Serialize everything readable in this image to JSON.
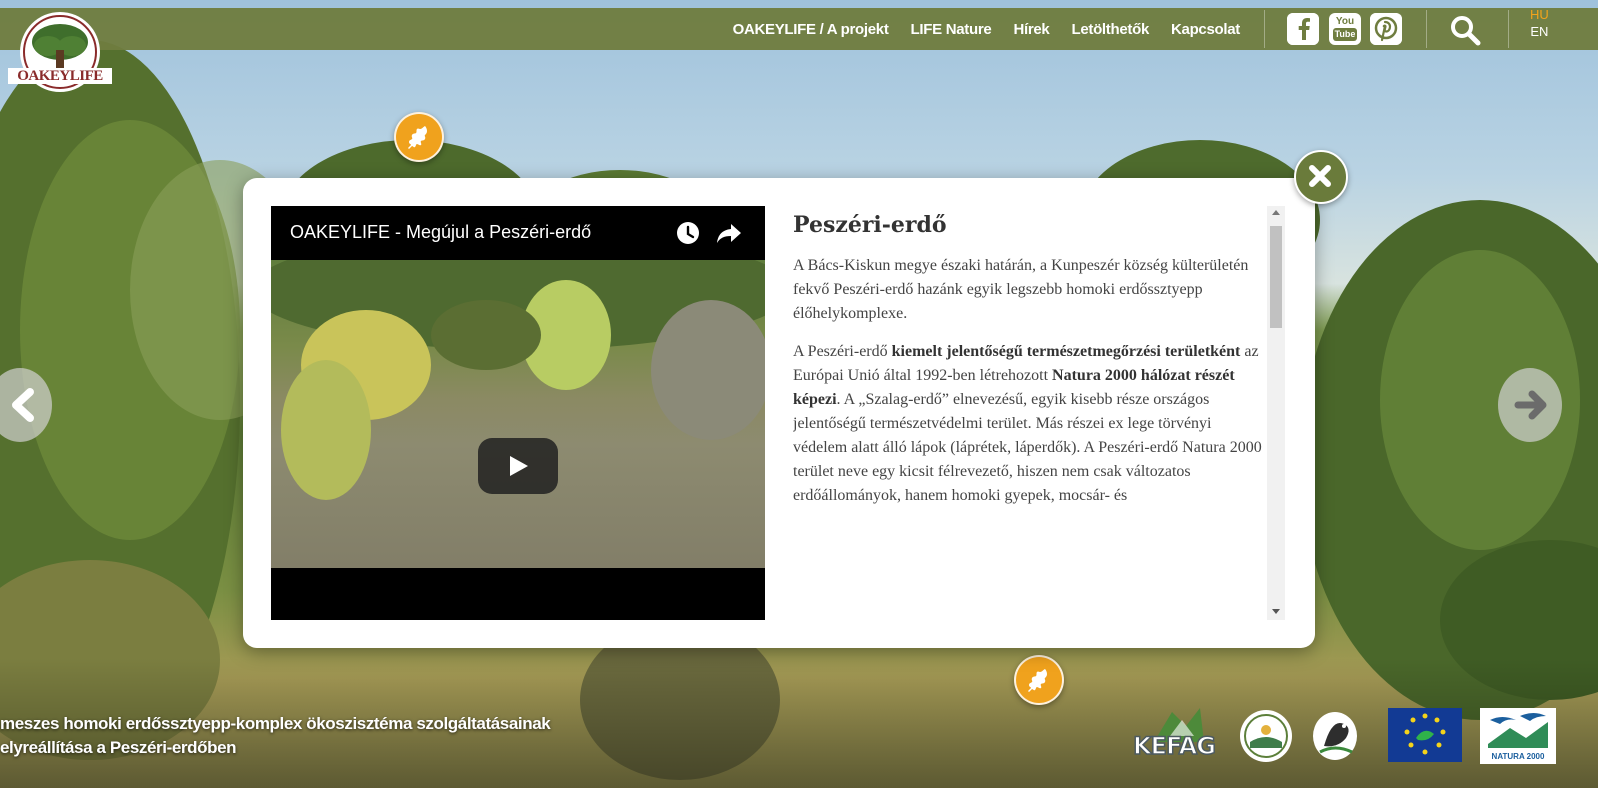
{
  "header": {
    "logo_text": "OAKEYLIFE",
    "nav": [
      {
        "label": "OAKEYLIFE / A projekt"
      },
      {
        "label": "LIFE Nature"
      },
      {
        "label": "Hírek"
      },
      {
        "label": "Letölthetők"
      },
      {
        "label": "Kapcsolat"
      }
    ],
    "social": {
      "youtube_top": "You",
      "youtube_bottom": "Tube"
    },
    "languages": {
      "active": "HU",
      "other": "EN"
    }
  },
  "modal": {
    "video": {
      "title": "OAKEYLIFE - Megújul a Peszéri-erdő"
    },
    "article": {
      "title": "Peszéri-erdő",
      "p1": "A Bács-Kiskun megye északi határán, a Kunpeszér község külterületén fekvő Peszéri-erdő hazánk egyik legszebb homoki erdőssztyepp élőhelykomplexe.",
      "p2_a": "A Peszéri-erdő ",
      "p2_b": "kiemelt jelentőségű természetmegőrzési területként",
      "p2_c": " az Európai Unió által 1992-ben létrehozott ",
      "p2_d": "Natura 2000 hálózat részét képezi",
      "p2_e": ". A „Szalag-erdő” elnevezésű, egyik kisebb része országos jelentőségű természetvédelmi terület.  Más részei ex lege törvényi védelem alatt álló lápok (láprétek, láperdők). A Peszéri-erdő Natura 2000 terület neve egy kicsit félrevezető, hiszen nem csak változatos erdőállományok, hanem homoki gyepek, mocsár- és"
    }
  },
  "caption": {
    "line1": "meszes homoki erdőssztyepp-komplex ökoszisztéma szolgáltatásainak",
    "line2": "elyreállítása a Peszéri-erdőben"
  },
  "partners": {
    "kefag": "KEFAG",
    "natura": "NATURA 2000"
  },
  "colors": {
    "topbar": "#6f7d3f",
    "hotspot": "#f0a21d",
    "close": "#6a7b3b",
    "lang_active": "#f2a31b"
  }
}
